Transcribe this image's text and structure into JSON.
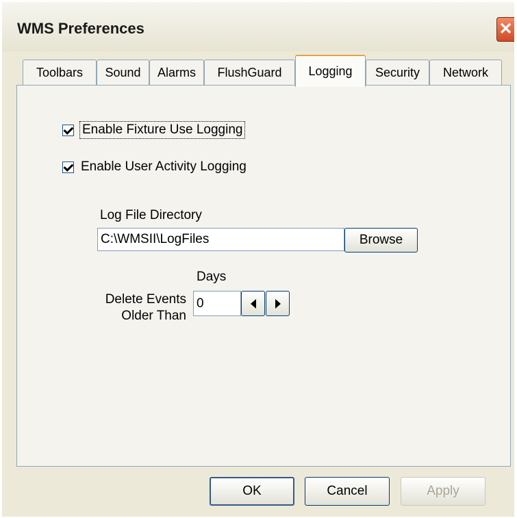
{
  "window": {
    "title": "WMS Preferences",
    "close_symbol": "✕"
  },
  "tabs": [
    {
      "label": "Toolbars",
      "active": false
    },
    {
      "label": "Sound",
      "active": false
    },
    {
      "label": "Alarms",
      "active": false
    },
    {
      "label": "FlushGuard",
      "active": false
    },
    {
      "label": "Logging",
      "active": true
    },
    {
      "label": "Security",
      "active": false
    },
    {
      "label": "Network",
      "active": false
    }
  ],
  "logging": {
    "fixture_use": {
      "label": "Enable Fixture Use Logging",
      "checked": true
    },
    "user_activity": {
      "label": "Enable User Activity Logging",
      "checked": true
    },
    "log_dir_label": "Log File Directory",
    "log_dir_value": "C:\\WMSII\\LogFiles",
    "browse_label": "Browse",
    "days_label": "Days",
    "delete_label_1": "Delete Events",
    "delete_label_2": "Older Than",
    "days_value": "0"
  },
  "buttons": {
    "ok": "OK",
    "cancel": "Cancel",
    "apply": "Apply"
  }
}
